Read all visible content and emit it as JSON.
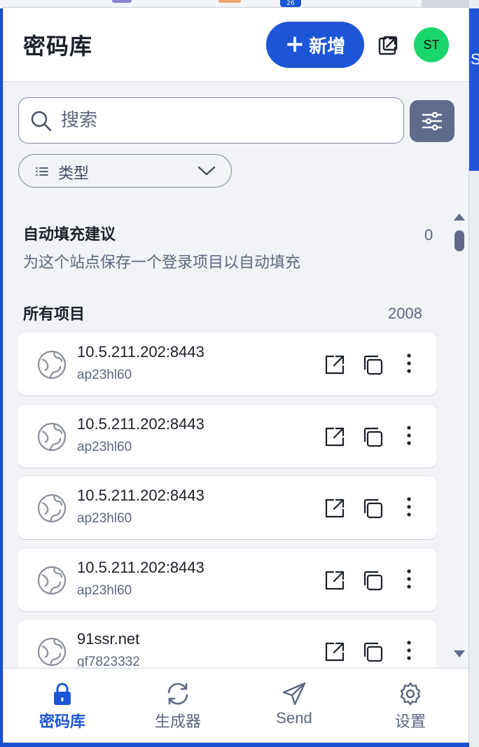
{
  "header": {
    "title": "密码库",
    "new_button_label": "新增",
    "avatar_initials": "ST"
  },
  "search": {
    "placeholder": "搜索"
  },
  "type_filter": {
    "label": "类型"
  },
  "autofill": {
    "title": "自动填充建议",
    "count": "0",
    "message": "为这个站点保存一个登录项目以自动填充"
  },
  "all_items": {
    "title": "所有项目",
    "count": "2008",
    "items": [
      {
        "name": "10.5.211.202:8443",
        "username": "ap23hl60"
      },
      {
        "name": "10.5.211.202:8443",
        "username": "ap23hl60"
      },
      {
        "name": "10.5.211.202:8443",
        "username": "ap23hl60"
      },
      {
        "name": "10.5.211.202:8443",
        "username": "ap23hl60"
      },
      {
        "name": "91ssr.net",
        "username": "gf7823332"
      }
    ]
  },
  "nav": {
    "vault": "密码库",
    "generator": "生成器",
    "send": "Send",
    "settings": "设置"
  },
  "background": {
    "badge": "26",
    "side_letter": "S"
  },
  "colors": {
    "primary": "#1c55d6",
    "avatar": "#19d66a",
    "filter_button": "#5f6a8c",
    "muted_text": "#5c6780"
  }
}
